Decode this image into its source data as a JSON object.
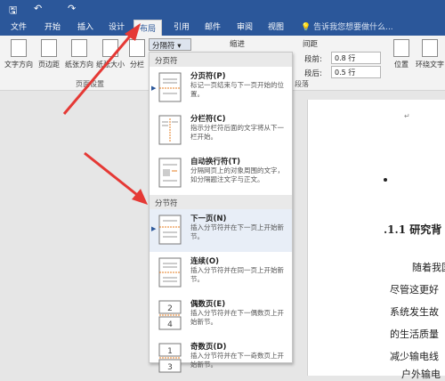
{
  "quick_access": {
    "save": "🖫",
    "undo": "↶",
    "redo": "↷"
  },
  "tabs": [
    "文件",
    "开始",
    "插入",
    "设计",
    "布局",
    "引用",
    "邮件",
    "审阅",
    "视图"
  ],
  "active_tab": "布局",
  "tell_me": "告诉我您想要做什么...",
  "ribbon": {
    "text_direction": "文字方向",
    "margins": "页边距",
    "orientation": "纸张方向",
    "size": "纸张大小",
    "columns": "分栏",
    "breaks": "分隔符",
    "page_setup_label": "页面设置",
    "indent_label": "缩进",
    "spacing_label": "间距",
    "before_label": "段前:",
    "after_label": "段后:",
    "before_value": "0.8 行",
    "after_value": "0.5 行",
    "paragraph_label": "段落",
    "position": "位置",
    "wrap_text": "环绕文字"
  },
  "menu": {
    "page_breaks_header": "分页符",
    "section_breaks_header": "分节符",
    "items": [
      {
        "title": "分页符(P)",
        "desc": "标记一页结束与下一页开始的位置。"
      },
      {
        "title": "分栏符(C)",
        "desc": "指示分栏符后面的文字将从下一栏开始。"
      },
      {
        "title": "自动换行符(T)",
        "desc": "分隔网页上的对象周围的文字，如分隔题注文字与正文。"
      },
      {
        "title": "下一页(N)",
        "desc": "插入分节符并在下一页上开始新节。"
      },
      {
        "title": "连续(O)",
        "desc": "插入分节符并在同一页上开始新节。"
      },
      {
        "title": "偶数页(E)",
        "desc": "插入分节符并在下一偶数页上开始新节。"
      },
      {
        "title": "奇数页(D)",
        "desc": "插入分节符并在下一奇数页上开始新节。"
      }
    ]
  },
  "document": {
    "heading": ".1.1 研究背",
    "lines": [
      "随着我国",
      "尽管这更好",
      "系统发生故",
      "的生活质量",
      "减少输电线",
      "户外输电"
    ]
  },
  "colors": {
    "brand": "#2b579a",
    "annotation_arrow": "#e53935"
  }
}
